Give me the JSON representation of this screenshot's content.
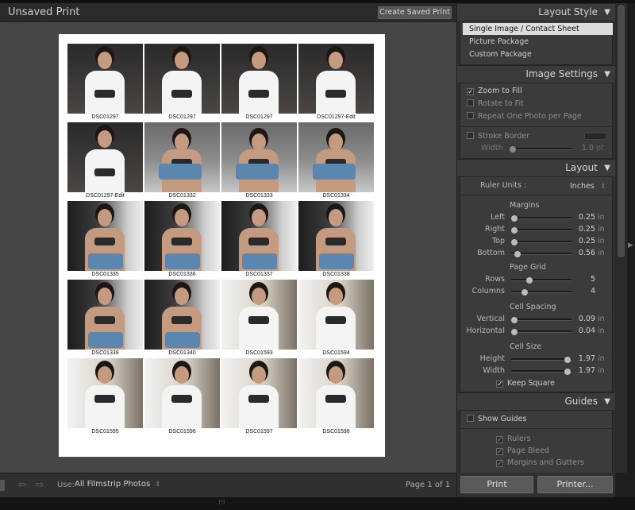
{
  "window": {
    "title": "Unsaved Print",
    "create_saved_print": "Create Saved Print"
  },
  "layout_style": {
    "title": "Layout Style",
    "items": [
      {
        "label": "Single Image / Contact Sheet",
        "selected": true
      },
      {
        "label": "Picture Package",
        "selected": false
      },
      {
        "label": "Custom Package",
        "selected": false
      }
    ]
  },
  "image_settings": {
    "title": "Image Settings",
    "zoom_to_fill": "Zoom to Fill",
    "rotate_to_fit": "Rotate to Fit",
    "repeat_one_photo": "Repeat One Photo per Page",
    "stroke_border": "Stroke Border",
    "width_label": "Width",
    "width_value": "1.0",
    "width_unit": "pt"
  },
  "layout": {
    "title": "Layout",
    "ruler_units_label": "Ruler Units :",
    "ruler_units_value": "Inches",
    "margins_title": "Margins",
    "margins": [
      {
        "label": "Left",
        "value": "0.25",
        "unit": "in",
        "level": 0.05
      },
      {
        "label": "Right",
        "value": "0.25",
        "unit": "in",
        "level": 0.05
      },
      {
        "label": "Top",
        "value": "0.25",
        "unit": "in",
        "level": 0.05
      },
      {
        "label": "Bottom",
        "value": "0.56",
        "unit": "in",
        "level": 0.1
      }
    ],
    "page_grid_title": "Page Grid",
    "page_grid": [
      {
        "label": "Rows",
        "value": "5",
        "level": 0.3
      },
      {
        "label": "Columns",
        "value": "4",
        "level": 0.22
      }
    ],
    "cell_spacing_title": "Cell Spacing",
    "cell_spacing": [
      {
        "label": "Vertical",
        "value": "0.09",
        "unit": "in",
        "level": 0.05
      },
      {
        "label": "Horizontal",
        "value": "0.04",
        "unit": "in",
        "level": 0.05
      }
    ],
    "cell_size_title": "Cell Size",
    "cell_size": [
      {
        "label": "Height",
        "value": "1.97",
        "unit": "in",
        "level": 0.93
      },
      {
        "label": "Width",
        "value": "1.97",
        "unit": "in",
        "level": 0.93
      }
    ],
    "keep_square": "Keep Square"
  },
  "guides": {
    "title": "Guides",
    "show_guides": "Show Guides",
    "items": [
      "Rulers",
      "Page Bleed",
      "Margins and Gutters"
    ]
  },
  "bottom_bar": {
    "use_label": "Use:",
    "use_value": "All Filmstrip Photos",
    "page_info": "Page 1 of 1"
  },
  "buttons": {
    "print": "Print",
    "printer": "Printer..."
  },
  "contact_sheet": {
    "captions": [
      "DSC01297",
      "DSC01297",
      "DSC01297",
      "DSC01297-Edit",
      "DSC01297-Edit",
      "DSC01332",
      "DSC01333",
      "DSC01334",
      "DSC01335",
      "DSC01336",
      "DSC01337",
      "DSC01338",
      "DSC01339",
      "DSC01340",
      "DSC01593",
      "DSC01594",
      "DSC01595",
      "DSC01596",
      "DSC01597",
      "DSC01598"
    ]
  },
  "colors": {
    "panel_bg": "#2f2f2f",
    "selection": "#dcdcdc",
    "work_area": "#464646"
  }
}
